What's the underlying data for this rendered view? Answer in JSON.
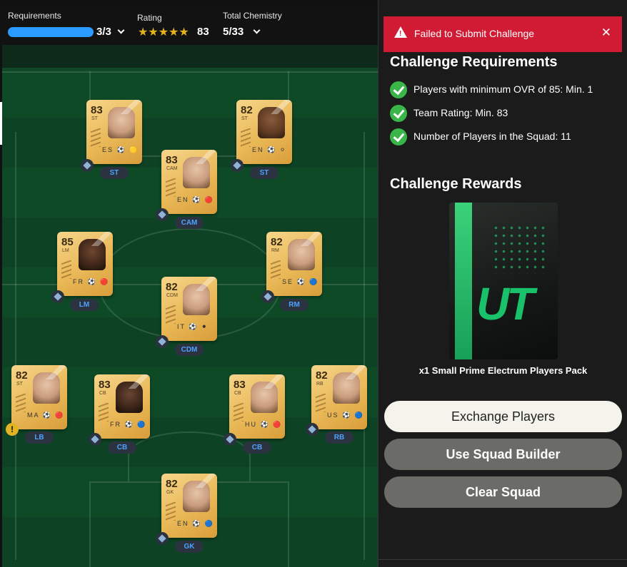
{
  "topbar": {
    "requirements_label": "Requirements",
    "requirements_value": "3/3",
    "requirements_progress": 1.0,
    "rating_label": "Rating",
    "rating_stars": "★★★★★",
    "rating_value": "83",
    "chemistry_label": "Total Chemistry",
    "chemistry_value": "5/33"
  },
  "players": [
    {
      "ovr": "83",
      "pos": "ST",
      "pill": "ST",
      "flags": "ES ⚽ 🟡"
    },
    {
      "ovr": "82",
      "pos": "ST",
      "pill": "ST",
      "flags": "EN ⚽ ⚪"
    },
    {
      "ovr": "83",
      "pos": "CAM",
      "pill": "CAM",
      "flags": "EN ⚽ 🔴"
    },
    {
      "ovr": "85",
      "pos": "LM",
      "pill": "LM",
      "flags": "FR ⚽ 🔴"
    },
    {
      "ovr": "82",
      "pos": "RM",
      "pill": "RM",
      "flags": "SE ⚽ 🔵"
    },
    {
      "ovr": "82",
      "pos": "CDM",
      "pill": "CDM",
      "flags": "IT ⚽ ⚫"
    },
    {
      "ovr": "82",
      "pos": "ST",
      "pill": "LB",
      "flags": "MA ⚽ 🔴"
    },
    {
      "ovr": "83",
      "pos": "CB",
      "pill": "CB",
      "flags": "FR ⚽ 🔵"
    },
    {
      "ovr": "83",
      "pos": "CB",
      "pill": "CB",
      "flags": "HU ⚽ 🔴"
    },
    {
      "ovr": "82",
      "pos": "RB",
      "pill": "RB",
      "flags": "US ⚽ 🔵"
    },
    {
      "ovr": "82",
      "pos": "GK",
      "pill": "GK",
      "flags": "EN ⚽ 🔵"
    }
  ],
  "error": {
    "message": "Failed to Submit Challenge",
    "close": "✕",
    "color": "#d11a34"
  },
  "requirements": {
    "title": "Challenge Requirements",
    "items": [
      "Players with minimum OVR of 85: Min. 1",
      "Team Rating: Min. 83",
      "Number of Players in the Squad: 11"
    ]
  },
  "rewards": {
    "title": "Challenge Rewards",
    "pack_logo": "UT",
    "pack_name": "x1 Small Prime Electrum Players Pack"
  },
  "buttons": {
    "exchange": "Exchange Players",
    "builder": "Use Squad Builder",
    "clear": "Clear Squad"
  }
}
